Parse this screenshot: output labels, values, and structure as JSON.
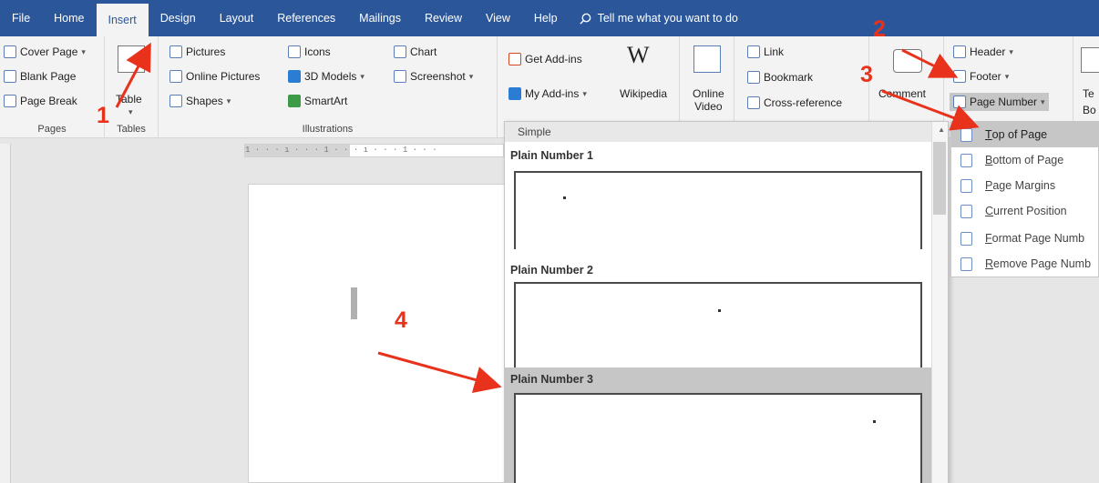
{
  "tabs": [
    "File",
    "Home",
    "Insert",
    "Design",
    "Layout",
    "References",
    "Mailings",
    "Review",
    "View",
    "Help"
  ],
  "active_tab": "Insert",
  "tell_me": "Tell me what you want to do",
  "groups": {
    "pages": {
      "label": "Pages",
      "items": [
        "Cover Page",
        "Blank Page",
        "Page Break"
      ]
    },
    "tables": {
      "label": "Tables",
      "table": "Table"
    },
    "illustrations": {
      "label": "Illustrations",
      "pictures": "Pictures",
      "online_pictures": "Online Pictures",
      "shapes": "Shapes",
      "icons": "Icons",
      "models": "3D Models",
      "smartart": "SmartArt",
      "chart": "Chart",
      "screenshot": "Screenshot"
    },
    "addins": {
      "get": "Get Add-ins",
      "my": "My Add-ins",
      "wikipedia": "Wikipedia"
    },
    "media": {
      "online_video_1": "Online",
      "online_video_2": "Video"
    },
    "links": {
      "link": "Link",
      "bookmark": "Bookmark",
      "cross": "Cross-reference"
    },
    "comments": {
      "comment": "Comment"
    },
    "header_footer": {
      "header": "Header",
      "footer": "Footer",
      "page_number": "Page Number"
    },
    "text_cut": {
      "a": "Te",
      "b": "Bo"
    }
  },
  "gallery": {
    "section": "Simple",
    "items": [
      "Plain Number 1",
      "Plain Number 2",
      "Plain Number 3"
    ],
    "selected_index": 2
  },
  "menu": {
    "items": [
      {
        "u": "T",
        "rest": "op of Page"
      },
      {
        "u": "B",
        "rest": "ottom of Page"
      },
      {
        "u": "P",
        "rest": "age Margins"
      },
      {
        "u": "C",
        "rest": "urrent Position"
      },
      {
        "u": "F",
        "rest": "ormat Page Numb"
      },
      {
        "u": "R",
        "rest": "emove Page Numb"
      }
    ],
    "hover_index": 0
  },
  "annotations": [
    "1",
    "2",
    "3",
    "4"
  ],
  "ruler_text": "1 · · · ı · · · 1 · · · ı · · · 1 · · ·",
  "colors": {
    "title_bar": "#2b579a",
    "annotation": "#e8321c",
    "selection": "#c6c6c6"
  }
}
